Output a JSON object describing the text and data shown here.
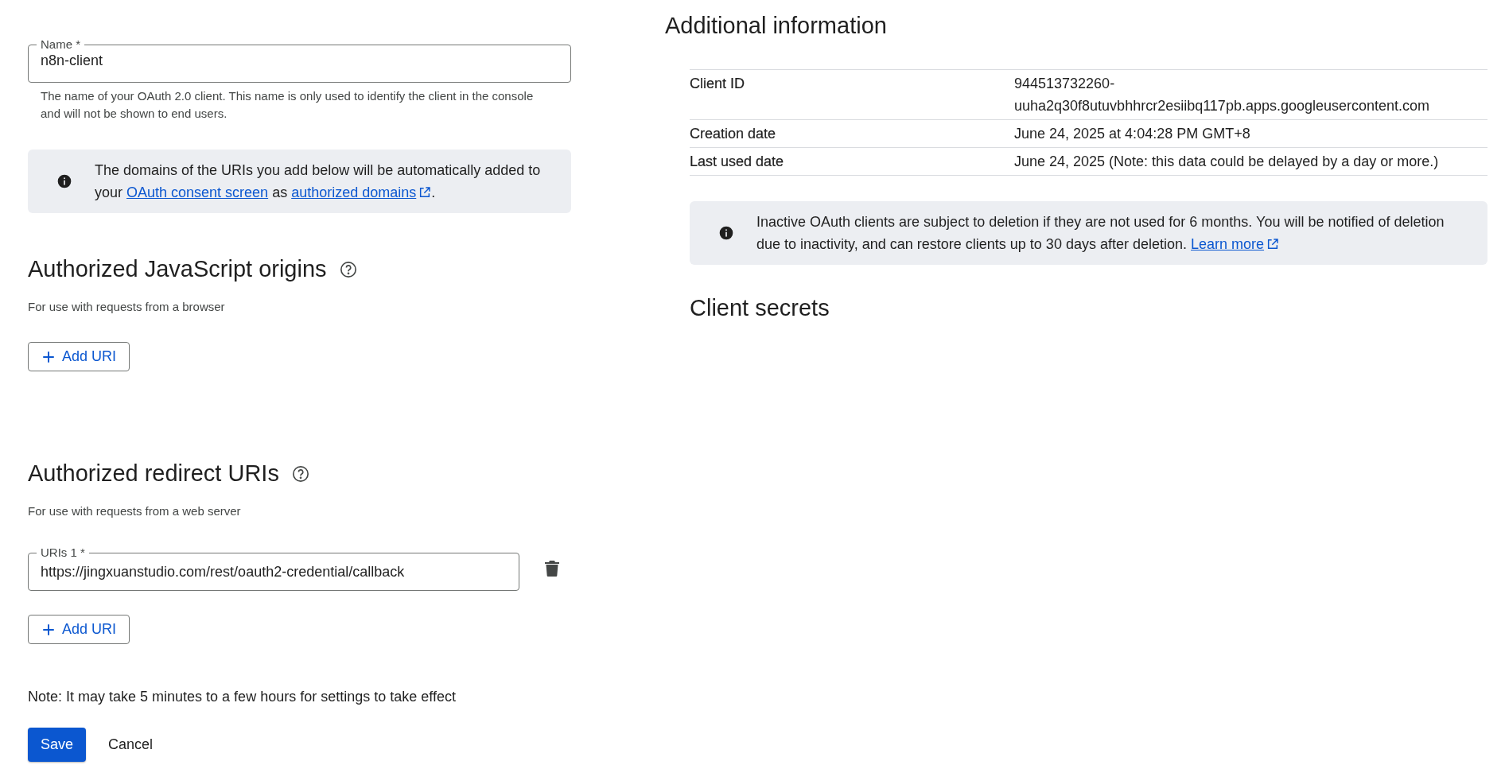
{
  "name_field": {
    "label": "Name *",
    "value": "n8n-client",
    "helper": "The name of your OAuth 2.0 client. This name is only used to identify the client in the console and will not be shown to end users."
  },
  "domains_notice": {
    "parts": [
      {
        "kind": "text",
        "text": "The domains of the URIs you add below will be automatically added to your "
      },
      {
        "kind": "link",
        "text": "OAuth consent screen",
        "external": false
      },
      {
        "kind": "text",
        "text": " as "
      },
      {
        "kind": "link",
        "text": "authorized domains",
        "external": true
      },
      {
        "kind": "text",
        "text": "."
      }
    ]
  },
  "js_origins": {
    "title": "Authorized JavaScript origins",
    "subtitle": "For use with requests from a browser",
    "add_button": "Add URI"
  },
  "redirect_uris": {
    "title": "Authorized redirect URIs",
    "subtitle": "For use with requests from a web server",
    "uris": [
      {
        "label": "URIs 1 *",
        "value": "https://jingxuanstudio.com/rest/oauth2-credential/callback"
      }
    ],
    "add_button": "Add URI"
  },
  "note": "Note: It may take 5 minutes to a few hours for settings to take effect",
  "buttons": [
    {
      "label": "Save",
      "kind": "primary"
    },
    {
      "label": "Cancel",
      "kind": "text"
    }
  ],
  "additional_info": {
    "title": "Additional information",
    "rows": [
      {
        "label": "Client ID",
        "value": "944513732260-\nuuha2q30f8utuvbhhrcr2esiibq117pb.apps.googleusercontent.com"
      },
      {
        "label": "Creation date",
        "value": "June 24, 2025 at 4:04:28 PM GMT+8"
      },
      {
        "label": "Last used date",
        "value": "June 24, 2025 (Note: this data could be delayed by a day or more.)"
      }
    ]
  },
  "inactive_notice": {
    "parts": [
      {
        "kind": "text",
        "text": "Inactive OAuth clients are subject to deletion if they are not used for 6 months. You will be notified of deletion due to inactivity, and can restore clients up to 30 days after deletion. "
      },
      {
        "kind": "link",
        "text": "Learn more",
        "external": true
      }
    ]
  },
  "client_secrets": {
    "title": "Client secrets"
  }
}
